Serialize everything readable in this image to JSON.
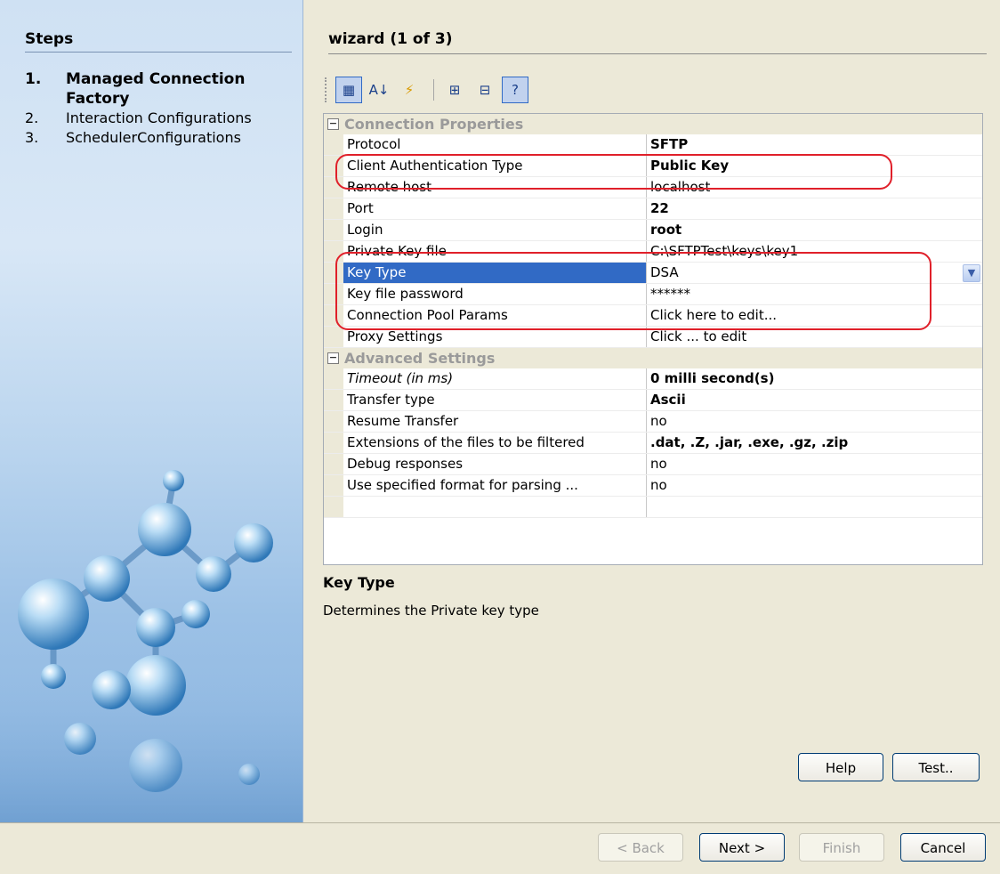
{
  "steps": {
    "header": "Steps",
    "items": [
      {
        "num": "1.",
        "label": "Managed Connection Factory"
      },
      {
        "num": "2.",
        "label": "Interaction Configurations"
      },
      {
        "num": "3.",
        "label": "SchedulerConfigurations"
      }
    ]
  },
  "wizard": {
    "title": "wizard (1 of 3)"
  },
  "toolbar": {
    "icons": [
      "categorized-icon",
      "sort-alpha-icon",
      "events-icon",
      "expand-icon",
      "collapse-icon",
      "help-view-icon"
    ],
    "glyphs": [
      "▦",
      "A↓",
      "⚡",
      "⊞",
      "⊟",
      "?"
    ]
  },
  "properties": {
    "categories": [
      {
        "label": "Connection Properties",
        "rows": [
          {
            "name": "Protocol",
            "value": "SFTP",
            "bold": true
          },
          {
            "name": "Client Authentication Type",
            "value": "Public Key",
            "bold": true
          },
          {
            "name": "Remote host",
            "value": "localhost"
          },
          {
            "name": "Port",
            "value": "22",
            "bold": true
          },
          {
            "name": "Login",
            "value": "root",
            "bold": true
          },
          {
            "name": "Private Key file",
            "value": "C:\\SFTPTest\\keys\\key1"
          },
          {
            "name": "Key Type",
            "value": "DSA",
            "selected": true
          },
          {
            "name": "Key file password",
            "value": "******"
          },
          {
            "name": "Connection Pool Params",
            "value": "Click here to edit..."
          },
          {
            "name": "Proxy Settings",
            "value": "Click ... to edit"
          }
        ]
      },
      {
        "label": "Advanced Settings",
        "rows": [
          {
            "name": "Timeout (in ms)",
            "value": "0 milli second(s)",
            "bold": true,
            "italic": true
          },
          {
            "name": "Transfer type",
            "value": "Ascii",
            "bold": true
          },
          {
            "name": "Resume Transfer",
            "value": "no"
          },
          {
            "name": "Extensions of the files to be filtered",
            "value": ".dat, .Z, .jar, .exe, .gz, .zip",
            "bold": true
          },
          {
            "name": "Debug responses",
            "value": "no"
          },
          {
            "name": "Use specified format for parsing ...",
            "value": "no"
          },
          {
            "name": "",
            "value": ""
          }
        ]
      }
    ]
  },
  "description": {
    "title": "Key Type",
    "text": "Determines the Private key type"
  },
  "buttons": {
    "help": "Help",
    "test": "Test..",
    "back": "< Back",
    "next": "Next >",
    "finish": "Finish",
    "cancel": "Cancel"
  },
  "colors": {
    "selection": "#316ac5",
    "highlight_annotation": "#e0202a"
  }
}
